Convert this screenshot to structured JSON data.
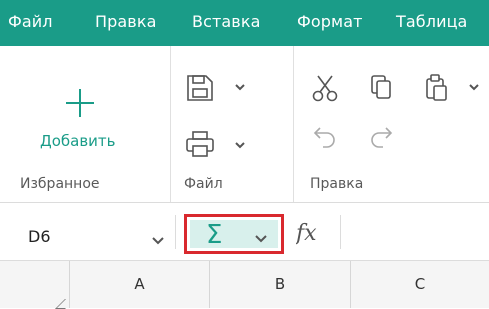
{
  "menu": {
    "items": [
      "Файл",
      "Правка",
      "Вставка",
      "Формат",
      "Таблица"
    ]
  },
  "ribbon": {
    "favorites": {
      "add_label": "Добавить",
      "group_label": "Избранное"
    },
    "file": {
      "group_label": "Файл"
    },
    "edit": {
      "group_label": "Правка"
    }
  },
  "formula_bar": {
    "cell_reference": "D6",
    "sum_symbol": "Σ",
    "fx_label": "fx"
  },
  "columns": [
    "A",
    "B",
    "C"
  ],
  "colors": {
    "accent": "#1a9c88",
    "highlight": "#d9292e",
    "sum_background": "#d8f0ec"
  },
  "icons": [
    "plus-icon",
    "save-icon",
    "print-icon",
    "cut-icon",
    "copy-icon",
    "paste-icon",
    "undo-icon",
    "redo-icon",
    "chevron-down-icon",
    "sum-icon",
    "fx-icon"
  ]
}
